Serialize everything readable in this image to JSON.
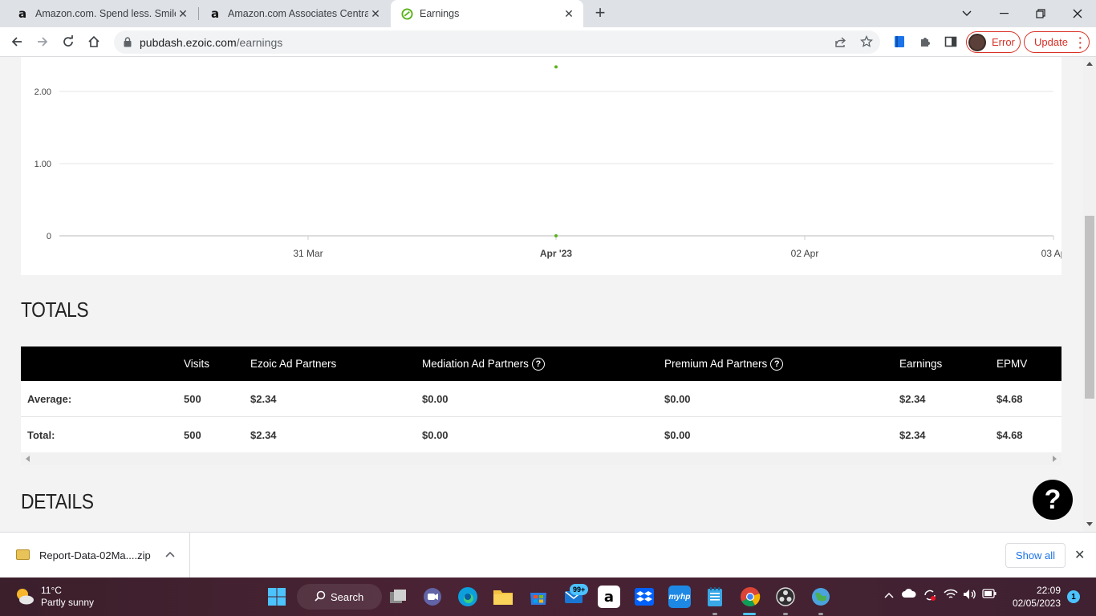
{
  "browser": {
    "tabs": [
      {
        "title": "Amazon.com. Spend less. Smile m",
        "favicon": "amazon-a"
      },
      {
        "title": "Amazon.com Associates Central -",
        "favicon": "amazon-a"
      },
      {
        "title": "Earnings",
        "favicon": "ezoic-logo"
      }
    ],
    "url_host": "pubdash.ezoic.com",
    "url_path": "/earnings",
    "error_label": "Error",
    "update_label": "Update"
  },
  "chart_data": {
    "type": "scatter",
    "title": "",
    "xlabel": "",
    "ylabel": "",
    "x_ticks": [
      "31 Mar",
      "Apr '23",
      "02 Apr",
      "03 Ap"
    ],
    "y_ticks": [
      "0",
      "1.00",
      "2.00"
    ],
    "ylim": [
      0,
      2.3
    ],
    "grid": true,
    "series": [
      {
        "color": "#5cb21c",
        "points": [
          {
            "x": "Apr '23",
            "y": 2.34
          },
          {
            "x": "Apr '23",
            "y": 0
          }
        ]
      }
    ]
  },
  "totals": {
    "title": "TOTALS",
    "headers": [
      "",
      "Visits",
      "Ezoic Ad Partners",
      "Mediation Ad Partners",
      "Premium Ad Partners",
      "Earnings",
      "EPMV"
    ],
    "rows": [
      {
        "label": "Average:",
        "cells": [
          "500",
          "$2.34",
          "$0.00",
          "$0.00",
          "$2.34",
          "$4.68"
        ]
      },
      {
        "label": "Total:",
        "cells": [
          "500",
          "$2.34",
          "$0.00",
          "$0.00",
          "$2.34",
          "$4.68"
        ]
      }
    ]
  },
  "details": {
    "title": "DETAILS"
  },
  "help_label": "?",
  "download": {
    "filename": "Report-Data-02Ma....zip",
    "show_all": "Show all"
  },
  "taskbar": {
    "weather_temp": "11°C",
    "weather_desc": "Partly sunny",
    "search_label": "Search",
    "mail_badge": "99+",
    "time": "22:09",
    "date": "02/05/2023",
    "notifications": "1"
  }
}
